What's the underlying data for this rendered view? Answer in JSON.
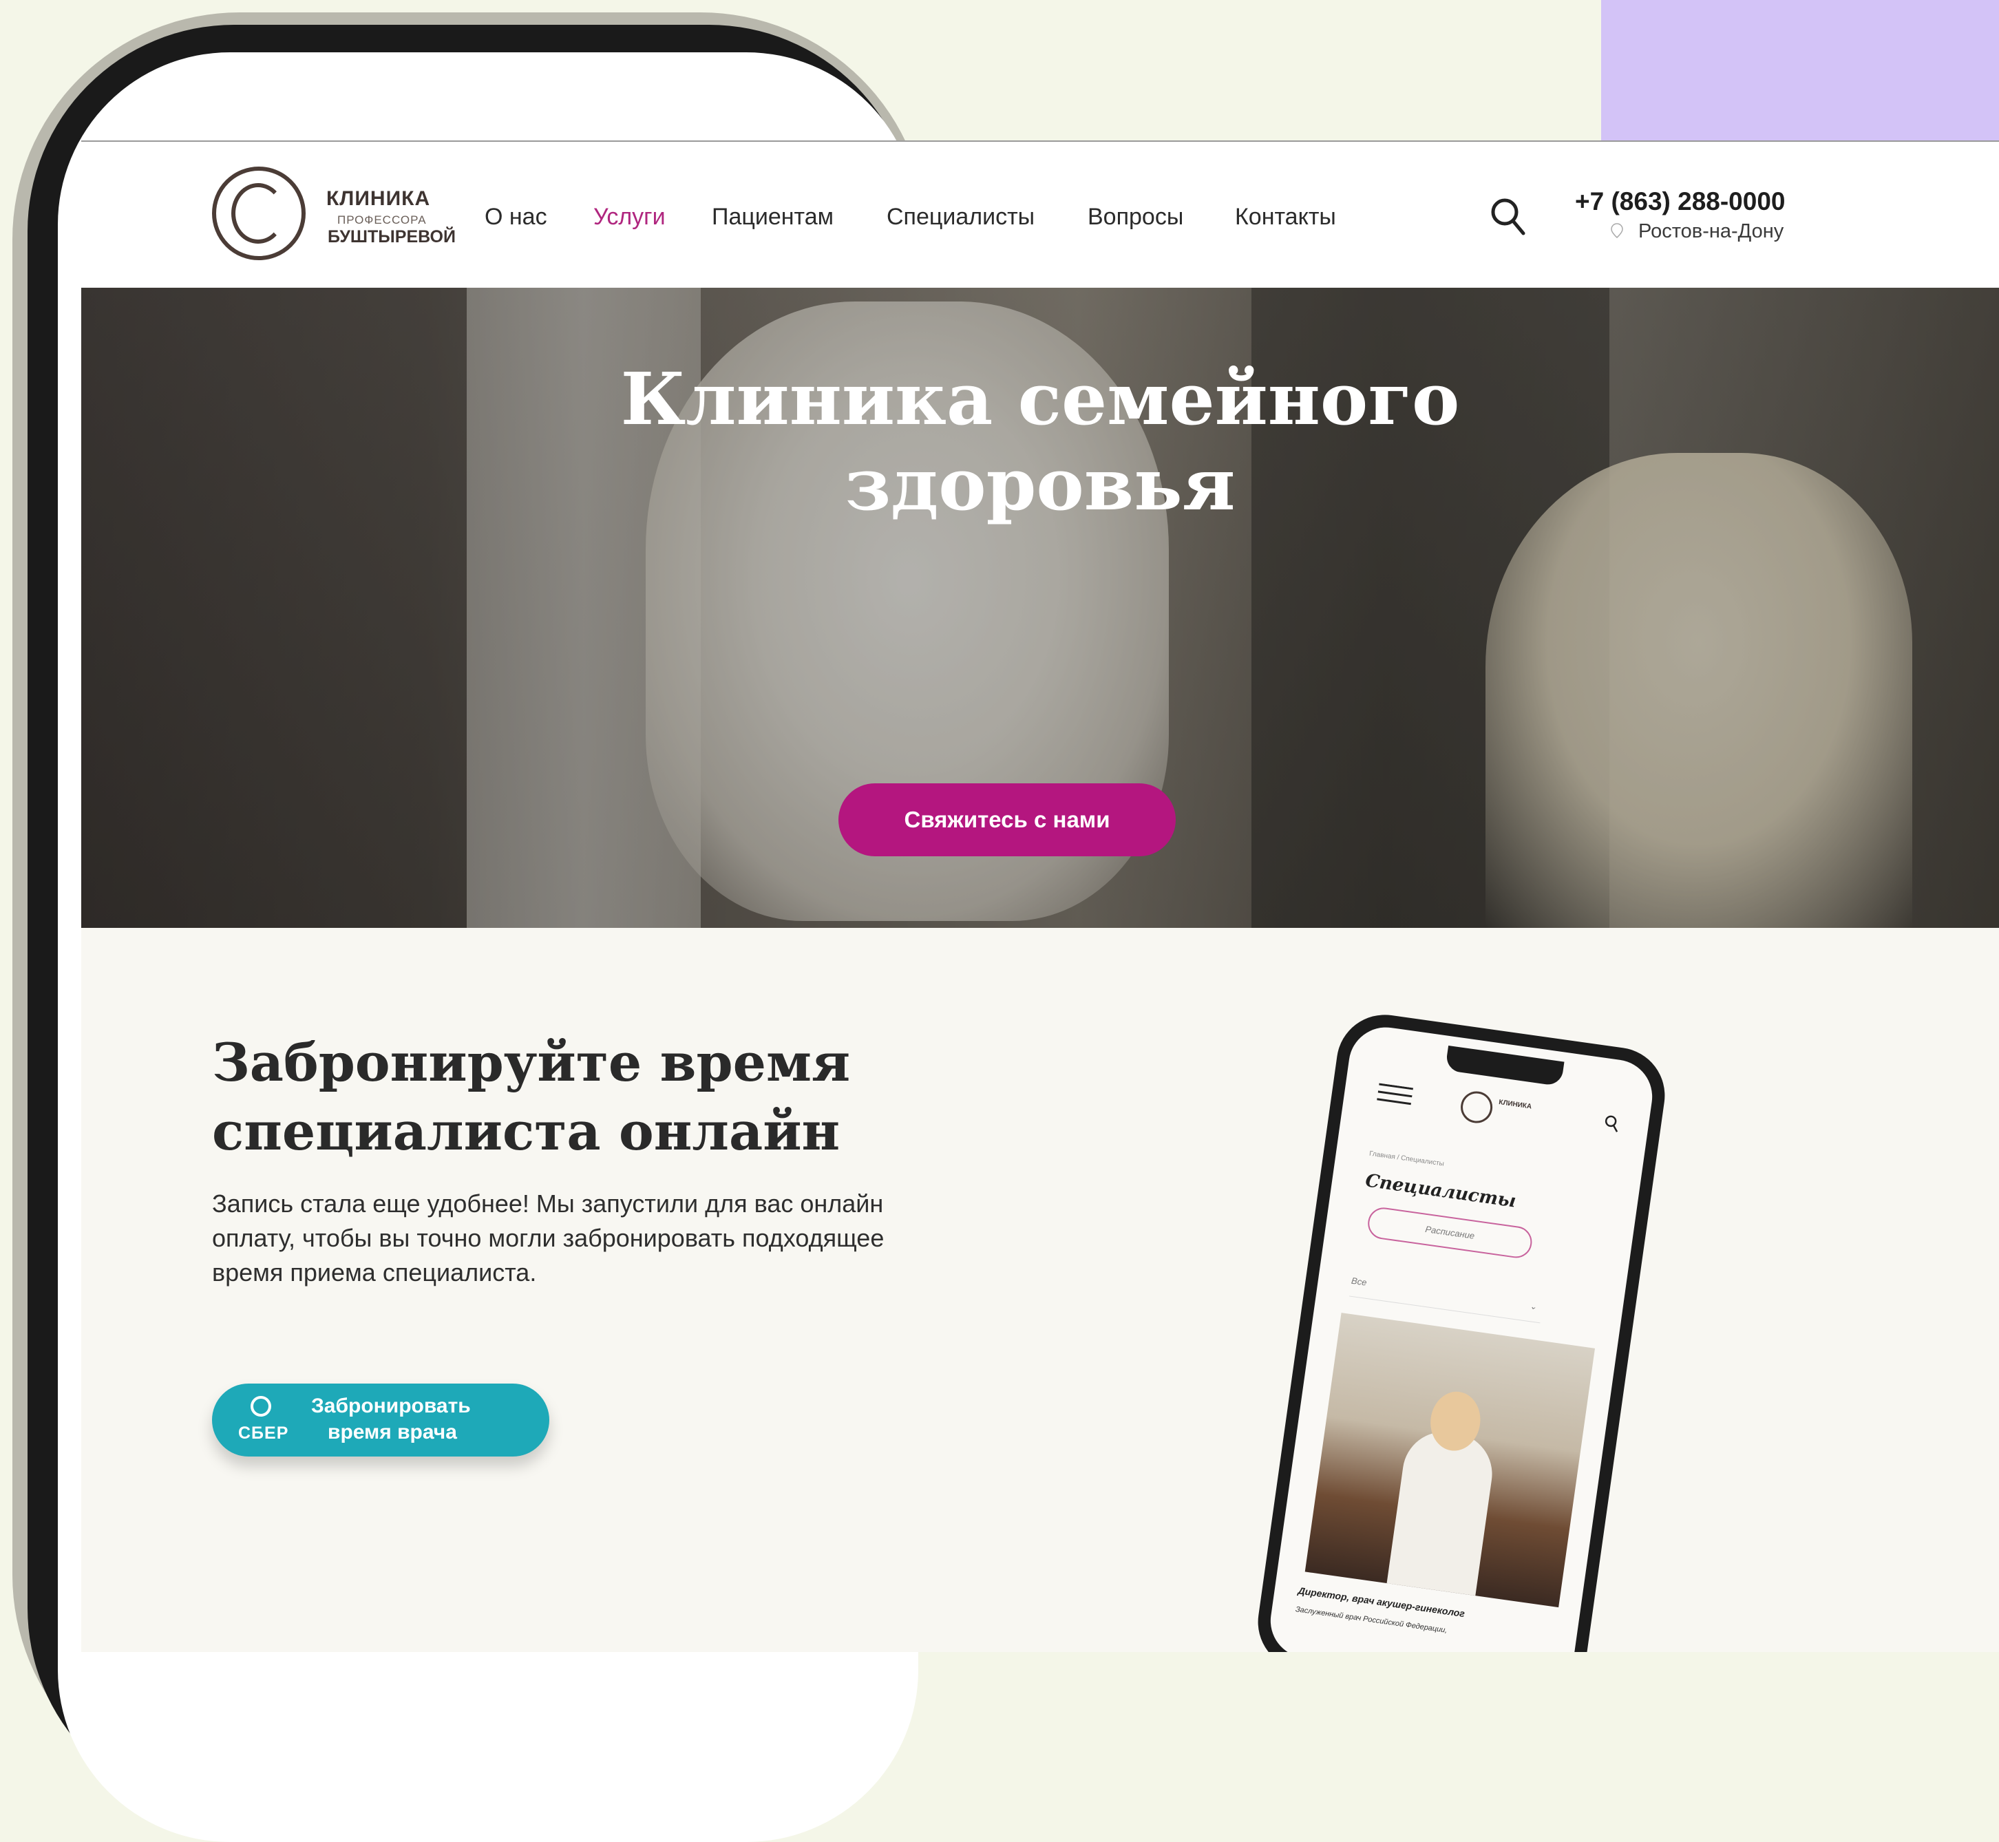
{
  "header": {
    "logo": {
      "line1": "КЛИНИКА",
      "line2": "ПРОФЕССОРА",
      "line3": "БУШТЫРЕВОЙ"
    },
    "nav": [
      {
        "label": "О нас",
        "active": false
      },
      {
        "label": "Услуги",
        "active": true
      },
      {
        "label": "Пациентам",
        "active": false
      },
      {
        "label": "Специалисты",
        "active": false
      },
      {
        "label": "Вопросы",
        "active": false
      },
      {
        "label": "Контакты",
        "active": false
      }
    ],
    "phone": "+7 (863) 288-0000",
    "city": "Ростов-на-Дону",
    "icons": {
      "search": "search-icon",
      "location": "location-pin-icon"
    }
  },
  "hero": {
    "title_line1": "Клиника семейного",
    "title_line2": "здоровья",
    "cta_label": "Свяжитесь с нами"
  },
  "booking": {
    "title_line1": "Забронируйте время",
    "title_line2": "специалиста онлайн",
    "text": "Запись стала еще удобнее! Мы запустили для вас онлайн оплату, чтобы вы точно могли забронировать подходящее время приема специалиста.",
    "button": {
      "brand": "СБЕР",
      "line1": "Забронировать",
      "line2": "время врача"
    }
  },
  "mini_phone": {
    "logo_text": "КЛИНИКА",
    "breadcrumb": "Главная / Специалисты",
    "title": "Специалисты",
    "schedule_button": "Расписание",
    "select_value": "Все",
    "caption1": "Директор, врач акушер-гинеколог",
    "caption2": "Заслуженный врач Российской Федерации,"
  },
  "colors": {
    "accent_magenta": "#b4167f",
    "nav_active": "#b0267f",
    "sber_teal": "#1ea9b8",
    "lavender": "#d3c3f7",
    "page_bg": "#f4f6e8"
  }
}
